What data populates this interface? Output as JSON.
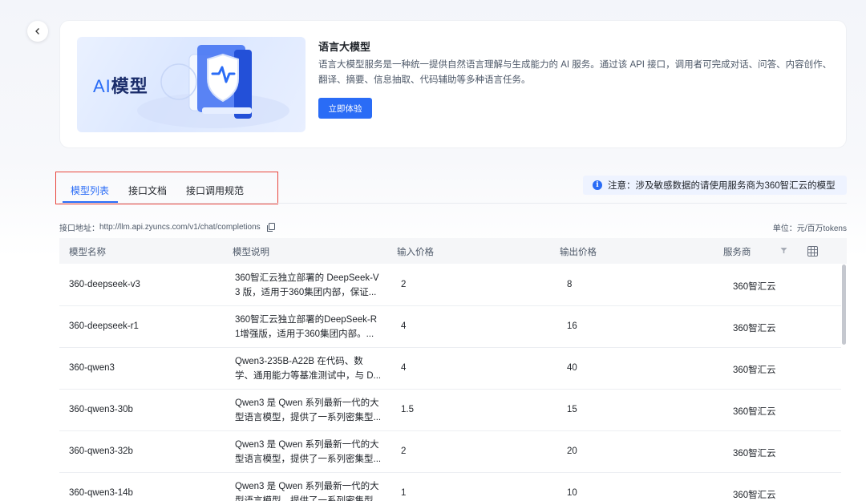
{
  "hero": {
    "image_text_ai": "AI",
    "image_text_model": "模型",
    "title": "语言大模型",
    "description": "语言大模型服务是一种统一提供自然语言理解与生成能力的 AI 服务。通过该 API 接口，调用者可完成对话、问答、内容创作、翻译、摘要、信息抽取、代码辅助等多种语言任务。",
    "try_button": "立即体验"
  },
  "tabs": [
    {
      "label": "模型列表",
      "active": true
    },
    {
      "label": "接口文档",
      "active": false
    },
    {
      "label": "接口调用规范",
      "active": false
    }
  ],
  "notice": {
    "icon": "info-icon",
    "text": "注意：涉及敏感数据的请使用服务商为360智汇云的模型"
  },
  "api": {
    "label": "接口地址：",
    "url": "http://llm.api.zyuncs.com/v1/chat/completions"
  },
  "unit": "单位：元/百万tokens",
  "table": {
    "headers": [
      "模型名称",
      "模型说明",
      "输入价格",
      "输出价格",
      "服务商"
    ],
    "rows": [
      {
        "name": "360-deepseek-v3",
        "desc1": "360智汇云独立部署的 DeepSeek-V",
        "desc2": "3 版，适用于360集团内部，保证...",
        "input": "2",
        "output": "8",
        "vendor": "360智汇云"
      },
      {
        "name": "360-deepseek-r1",
        "desc1": "360智汇云独立部署的DeepSeek-R",
        "desc2": "1增强版，适用于360集团内部。...",
        "input": "4",
        "output": "16",
        "vendor": "360智汇云"
      },
      {
        "name": "360-qwen3",
        "desc1": "Qwen3-235B-A22B 在代码、数",
        "desc2": "学、通用能力等基准测试中，与 D...",
        "input": "4",
        "output": "40",
        "vendor": "360智汇云"
      },
      {
        "name": "360-qwen3-30b",
        "desc1": "Qwen3 是 Qwen 系列最新一代的大",
        "desc2": "型语言模型，提供了一系列密集型...",
        "input": "1.5",
        "output": "15",
        "vendor": "360智汇云"
      },
      {
        "name": "360-qwen3-32b",
        "desc1": "Qwen3 是 Qwen 系列最新一代的大",
        "desc2": "型语言模型，提供了一系列密集型...",
        "input": "2",
        "output": "20",
        "vendor": "360智汇云"
      },
      {
        "name": "360-qwen3-14b",
        "desc1": "Qwen3 是 Qwen 系列最新一代的大",
        "desc2": "型语言模型，提供了一系列密集型...",
        "input": "1",
        "output": "10",
        "vendor": "360智汇云"
      }
    ]
  },
  "colors": {
    "accent": "#2a6cf6",
    "highlight_border": "#e8453c"
  }
}
